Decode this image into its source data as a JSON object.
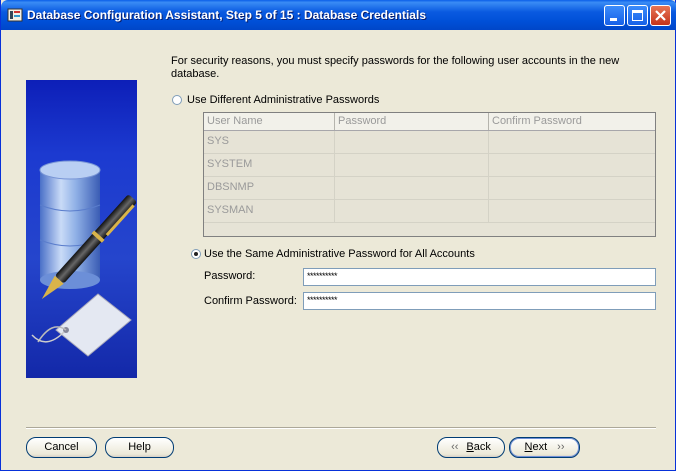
{
  "window": {
    "title": "Database Configuration Assistant, Step 5 of 15 : Database Credentials"
  },
  "intro": "For security reasons, you must specify passwords for the following user accounts in the new database.",
  "options": {
    "different": "Use Different Administrative Passwords",
    "same": "Use the Same Administrative Password for All Accounts",
    "selected": "same"
  },
  "table": {
    "headers": [
      "User Name",
      "Password",
      "Confirm Password"
    ],
    "rows": [
      [
        "SYS",
        "",
        ""
      ],
      [
        "SYSTEM",
        "",
        ""
      ],
      [
        "DBSNMP",
        "",
        ""
      ],
      [
        "SYSMAN",
        "",
        ""
      ]
    ]
  },
  "fields": {
    "password_label": "Password:",
    "password_value": "**********",
    "confirm_label": "Confirm Password:",
    "confirm_value": "**********"
  },
  "buttons": {
    "cancel": "Cancel",
    "help": "Help",
    "back_prefix": "B",
    "back_rest": "ack",
    "next_prefix": "N",
    "next_rest": "ext"
  },
  "colors": {
    "titlebar": "#0a5ae0",
    "art_bg": "#1c3ad0",
    "window_bg": "#ece9d8"
  },
  "icons": [
    "app-icon",
    "minimize-icon",
    "maximize-icon",
    "close-icon",
    "back-arrow-icon",
    "next-arrow-icon"
  ]
}
